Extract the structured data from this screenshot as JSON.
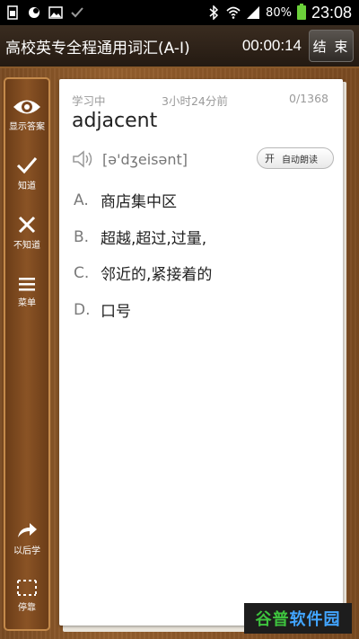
{
  "status_bar": {
    "battery": "80%",
    "time": "23:08",
    "icons": [
      "sim-icon",
      "circle-app-icon",
      "image-icon",
      "check-icon",
      "bluetooth-icon",
      "wifi-icon",
      "signal-icon",
      "battery-icon"
    ]
  },
  "header": {
    "title": "高校英专全程通用词汇(A-I)",
    "timer": "00:00:14",
    "end_label": "结 束"
  },
  "sidebar": {
    "items": [
      {
        "label": "显示答案",
        "icon": "eye-icon"
      },
      {
        "label": "知道",
        "icon": "check-icon"
      },
      {
        "label": "不知道",
        "icon": "close-icon"
      },
      {
        "label": "菜单",
        "icon": "menu-icon"
      },
      {
        "label": "以后学",
        "icon": "share-arrow-icon"
      },
      {
        "label": "停靠",
        "icon": "dock-icon"
      }
    ]
  },
  "card": {
    "status": "学习中",
    "elapsed": "3小时24分前",
    "progress": "0/1368",
    "word": "adjacent",
    "phonetic": "[ə'dʒeisənt]",
    "auto_read_state": "开",
    "auto_read_label": "自动朗读",
    "options": [
      {
        "key": "A.",
        "text": "商店集中区"
      },
      {
        "key": "B.",
        "text": "超越,超过,过量,"
      },
      {
        "key": "C.",
        "text": "邻近的,紧接着的"
      },
      {
        "key": "D.",
        "text": "口号"
      }
    ]
  },
  "watermark": {
    "part1": "谷普",
    "part2": "软件园"
  }
}
